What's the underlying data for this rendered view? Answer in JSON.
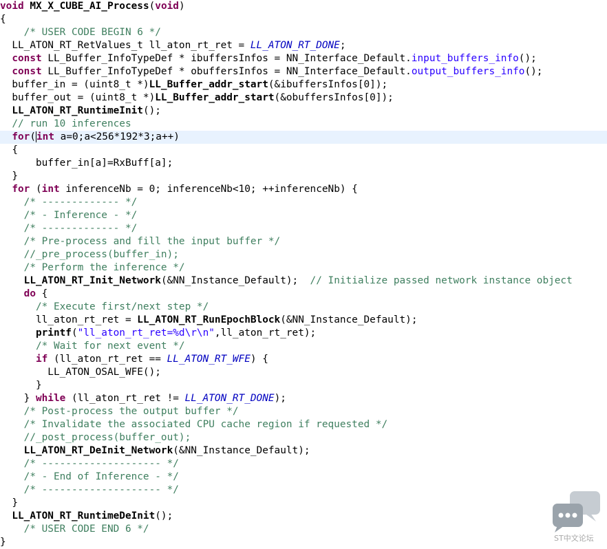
{
  "watermark": {
    "text": "ST中文论坛"
  },
  "lines": [
    [
      {
        "t": "void",
        "c": "kw"
      },
      {
        "t": " "
      },
      {
        "t": "MX_X_CUBE_AI_Process",
        "c": "fn"
      },
      {
        "t": "("
      },
      {
        "t": "void",
        "c": "kw"
      },
      {
        "t": ")"
      }
    ],
    [
      {
        "t": "{"
      }
    ],
    [
      {
        "t": "    "
      },
      {
        "t": "/* USER CODE BEGIN 6 */",
        "c": "cm"
      }
    ],
    [
      {
        "t": "  LL_ATON_RT_RetValues_t ll_aton_rt_ret = "
      },
      {
        "t": "LL_ATON_RT_DONE",
        "c": "mac"
      },
      {
        "t": ";"
      }
    ],
    [
      {
        "t": "  "
      },
      {
        "t": "const",
        "c": "kw"
      },
      {
        "t": " LL_Buffer_InfoTypeDef * ibuffersInfos = NN_Interface_Default."
      },
      {
        "t": "input_buffers_info",
        "c": "str"
      },
      {
        "t": "();"
      }
    ],
    [
      {
        "t": "  "
      },
      {
        "t": "const",
        "c": "kw"
      },
      {
        "t": " LL_Buffer_InfoTypeDef * obuffersInfos = NN_Interface_Default."
      },
      {
        "t": "output_buffers_info",
        "c": "str"
      },
      {
        "t": "();"
      }
    ],
    [
      {
        "t": "  buffer_in = (uint8_t *)"
      },
      {
        "t": "LL_Buffer_addr_start",
        "c": "fn"
      },
      {
        "t": "(&ibuffersInfos[0]);"
      }
    ],
    [
      {
        "t": "  buffer_out = (uint8_t *)"
      },
      {
        "t": "LL_Buffer_addr_start",
        "c": "fn"
      },
      {
        "t": "(&obuffersInfos[0]);"
      }
    ],
    [
      {
        "t": "  "
      },
      {
        "t": "LL_ATON_RT_RuntimeInit",
        "c": "fn"
      },
      {
        "t": "();"
      }
    ],
    [
      {
        "t": "  "
      },
      {
        "t": "// run 10 inferences",
        "c": "cm"
      }
    ],
    [
      {
        "t": "  "
      },
      {
        "t": "for",
        "c": "kw"
      },
      {
        "t": "("
      },
      {
        "caret": true
      },
      {
        "t": "int",
        "c": "kw"
      },
      {
        "t": " a=0;a<256*192*3;a++)"
      }
    ],
    [
      {
        "t": "  {"
      }
    ],
    [
      {
        "t": "      buffer_in[a]=RxBuff[a];"
      }
    ],
    [
      {
        "t": "  }"
      }
    ],
    [
      {
        "t": "  "
      },
      {
        "t": "for",
        "c": "kw"
      },
      {
        "t": " ("
      },
      {
        "t": "int",
        "c": "kw"
      },
      {
        "t": " inferenceNb = 0; inferenceNb<10; ++inferenceNb) {"
      }
    ],
    [
      {
        "t": "    "
      },
      {
        "t": "/* ------------- */",
        "c": "cm"
      }
    ],
    [
      {
        "t": "    "
      },
      {
        "t": "/* - Inference - */",
        "c": "cm"
      }
    ],
    [
      {
        "t": "    "
      },
      {
        "t": "/* ------------- */",
        "c": "cm"
      }
    ],
    [
      {
        "t": "    "
      },
      {
        "t": "/* Pre-process and fill the input buffer */",
        "c": "cm"
      }
    ],
    [
      {
        "t": "    "
      },
      {
        "t": "//_pre_process(buffer_in);",
        "c": "cm"
      }
    ],
    [
      {
        "t": "    "
      },
      {
        "t": "/* Perform the inference */",
        "c": "cm"
      }
    ],
    [
      {
        "t": "    "
      },
      {
        "t": "LL_ATON_RT_Init_Network",
        "c": "fn"
      },
      {
        "t": "(&NN_Instance_Default);  "
      },
      {
        "t": "// Initialize passed network instance object",
        "c": "cm"
      }
    ],
    [
      {
        "t": "    "
      },
      {
        "t": "do",
        "c": "kw"
      },
      {
        "t": " {"
      }
    ],
    [
      {
        "t": "      "
      },
      {
        "t": "/* Execute first/next step */",
        "c": "cm"
      }
    ],
    [
      {
        "t": "      ll_aton_rt_ret = "
      },
      {
        "t": "LL_ATON_RT_RunEpochBlock",
        "c": "fn"
      },
      {
        "t": "(&NN_Instance_Default);"
      }
    ],
    [
      {
        "t": "      "
      },
      {
        "t": "printf",
        "c": "fn"
      },
      {
        "t": "("
      },
      {
        "t": "\"ll_aton_rt_ret=%d\\r\\n\"",
        "c": "str"
      },
      {
        "t": ",ll_aton_rt_ret);"
      }
    ],
    [
      {
        "t": "      "
      },
      {
        "t": "/* Wait for next event */",
        "c": "cm"
      }
    ],
    [
      {
        "t": "      "
      },
      {
        "t": "if",
        "c": "kw"
      },
      {
        "t": " (ll_aton_rt_ret == "
      },
      {
        "t": "LL_ATON_RT_WFE",
        "c": "mac"
      },
      {
        "t": ") {"
      }
    ],
    [
      {
        "t": "        LL_ATON_OSAL_WFE();"
      }
    ],
    [
      {
        "t": "      }"
      }
    ],
    [
      {
        "t": "    } "
      },
      {
        "t": "while",
        "c": "kw"
      },
      {
        "t": " (ll_aton_rt_ret != "
      },
      {
        "t": "LL_ATON_RT_DONE",
        "c": "mac"
      },
      {
        "t": ");"
      }
    ],
    [
      {
        "t": "    "
      },
      {
        "t": "/* Post-process the output buffer */",
        "c": "cm"
      }
    ],
    [
      {
        "t": "    "
      },
      {
        "t": "/* Invalidate the associated CPU cache region if requested */",
        "c": "cm"
      }
    ],
    [
      {
        "t": "    "
      },
      {
        "t": "//_post_process(buffer_out);",
        "c": "cm"
      }
    ],
    [
      {
        "t": "    "
      },
      {
        "t": "LL_ATON_RT_DeInit_Network",
        "c": "fn"
      },
      {
        "t": "(&NN_Instance_Default);"
      }
    ],
    [
      {
        "t": "    "
      },
      {
        "t": "/* -------------------- */",
        "c": "cm"
      }
    ],
    [
      {
        "t": "    "
      },
      {
        "t": "/* - End of Inference - */",
        "c": "cm"
      }
    ],
    [
      {
        "t": "    "
      },
      {
        "t": "/* -------------------- */",
        "c": "cm"
      }
    ],
    [
      {
        "t": "  }"
      }
    ],
    [
      {
        "t": "  "
      },
      {
        "t": "LL_ATON_RT_RuntimeDeInit",
        "c": "fn"
      },
      {
        "t": "();"
      }
    ],
    [
      {
        "t": "    "
      },
      {
        "t": "/* USER CODE END 6 */",
        "c": "cm"
      }
    ],
    [
      {
        "t": "}"
      }
    ]
  ],
  "current_line": 10
}
